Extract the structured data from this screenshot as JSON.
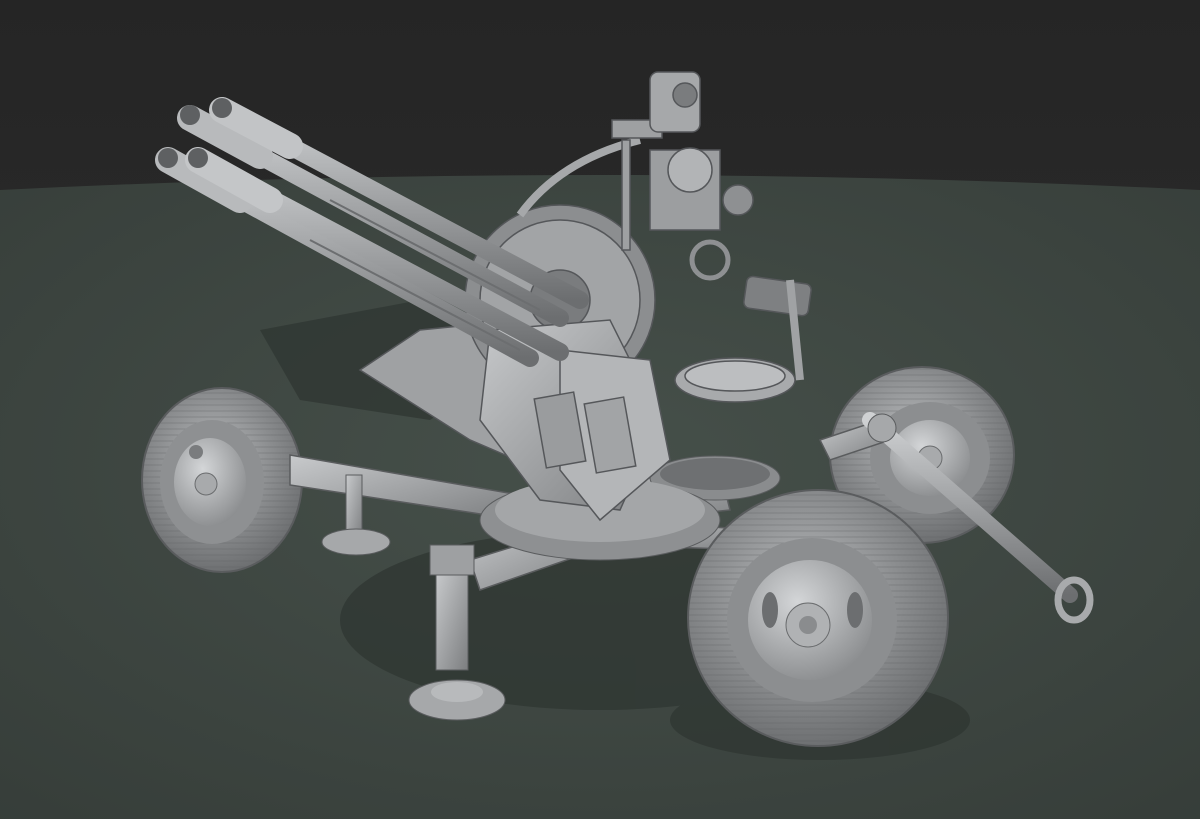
{
  "scene": {
    "subject": "twin-barrel-anti-aircraft-gun-model",
    "colors": {
      "sky": "#2b2b2b",
      "ground": "#3d4540",
      "model": "#9a9c9e",
      "model_light": "#c4c6c8",
      "model_dark": "#5a5c5e",
      "shadow": "#2e3430"
    }
  }
}
